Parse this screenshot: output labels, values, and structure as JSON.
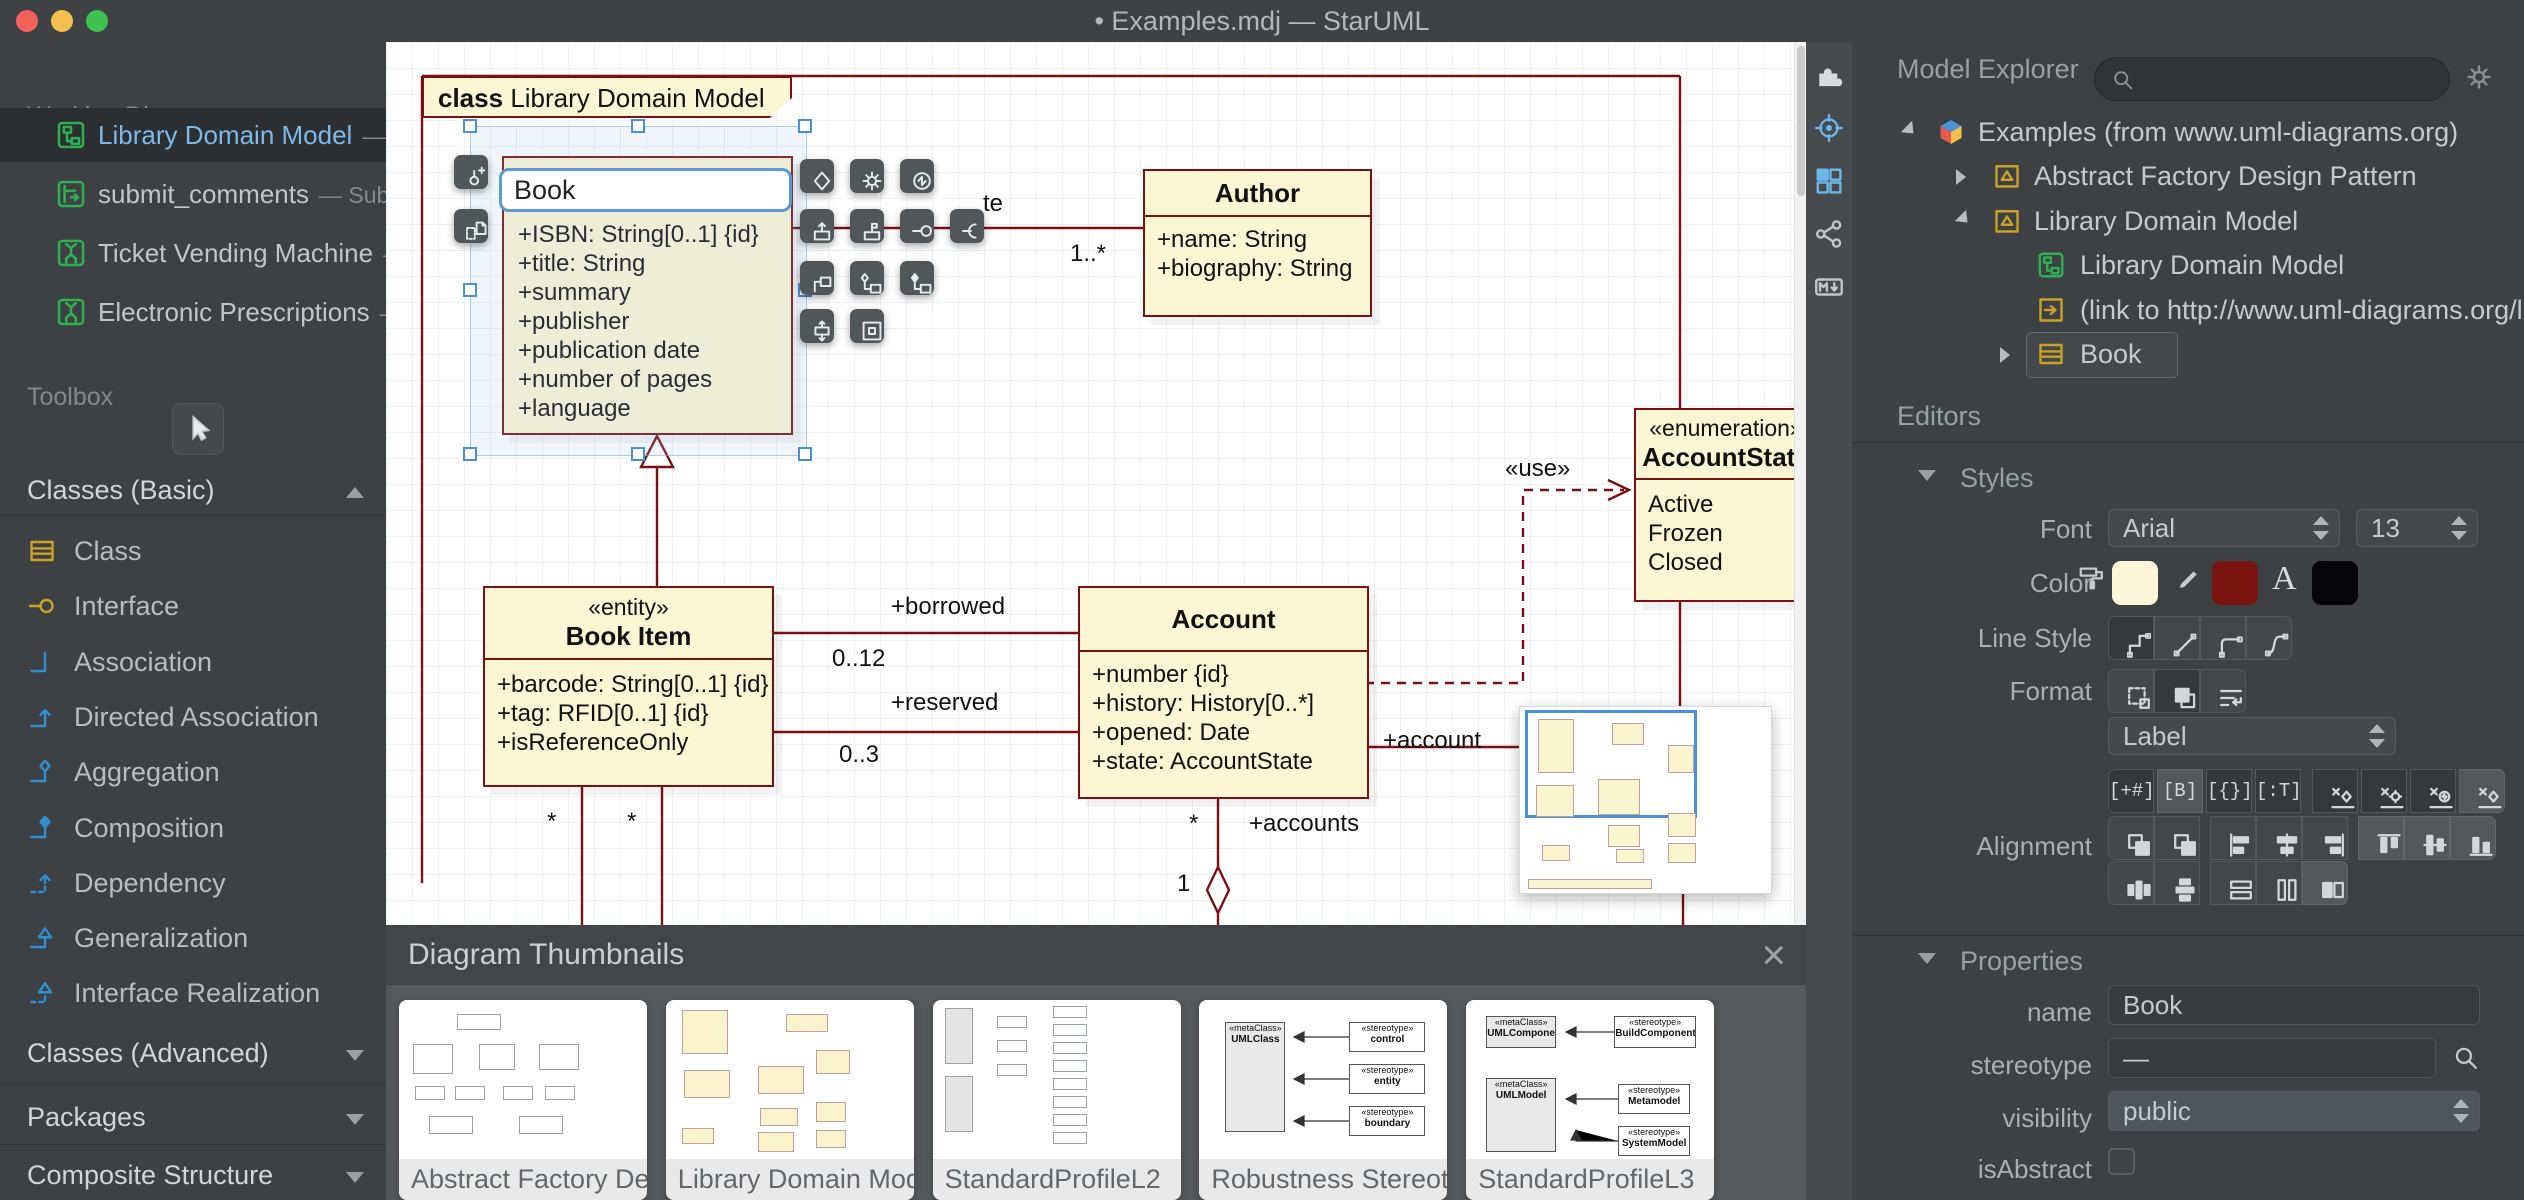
{
  "titlebar": {
    "title": "• Examples.mdj — StarUML"
  },
  "sidebar": {
    "working_diagrams_label": "Working Diagrams",
    "diagrams": [
      {
        "name": "Library Domain Model",
        "suffix": "— Lib",
        "icon": "doc-class",
        "selected": true
      },
      {
        "name": "submit_comments",
        "suffix": "— Submit",
        "icon": "doc-seq",
        "selected": false
      },
      {
        "name": "Ticket Vending Machine",
        "suffix": "— T",
        "icon": "doc-act",
        "selected": false
      },
      {
        "name": "Electronic Prescriptions",
        "suffix": "— E",
        "icon": "doc-act",
        "selected": false
      }
    ],
    "toolbox_label": "Toolbox",
    "sections": [
      {
        "label": "Classes (Basic)",
        "expanded": true,
        "items": [
          {
            "label": "Class",
            "icon": "tb-class",
            "color": "#c9a227"
          },
          {
            "label": "Interface",
            "icon": "tb-interface",
            "color": "#c9a227"
          },
          {
            "label": "Association",
            "icon": "tb-assoc",
            "color": "#2f8fd0"
          },
          {
            "label": "Directed Association",
            "icon": "tb-dassoc",
            "color": "#2f8fd0"
          },
          {
            "label": "Aggregation",
            "icon": "tb-aggr",
            "color": "#2f8fd0"
          },
          {
            "label": "Composition",
            "icon": "tb-comp",
            "color": "#2f8fd0"
          },
          {
            "label": "Dependency",
            "icon": "tb-dep",
            "color": "#2f8fd0"
          },
          {
            "label": "Generalization",
            "icon": "tb-gen",
            "color": "#2f8fd0"
          },
          {
            "label": "Interface Realization",
            "icon": "tb-ireal",
            "color": "#2f8fd0"
          }
        ]
      },
      {
        "label": "Classes (Advanced)",
        "expanded": false,
        "items": []
      },
      {
        "label": "Packages",
        "expanded": false,
        "items": []
      },
      {
        "label": "Composite Structure",
        "expanded": false,
        "items": []
      }
    ]
  },
  "canvas": {
    "frame": {
      "keyword": "class",
      "name": "Library Domain Model"
    },
    "book": {
      "name_value": "Book",
      "attributes": [
        "+ISBN: String[0..1] {id}",
        "+title: String",
        "+summary",
        "+publisher",
        "+publication date",
        "+number of pages",
        "+language"
      ]
    },
    "author": {
      "title": "Author",
      "attributes": [
        "+name: String",
        "+biography: String"
      ]
    },
    "book_item": {
      "stereotype": "«entity»",
      "title": "Book Item",
      "attributes": [
        "+barcode: String[0..1] {id}",
        "+tag: RFID[0..1] {id}",
        "+isReferenceOnly"
      ]
    },
    "account": {
      "title": "Account",
      "attributes": [
        "+number {id}",
        "+history: History[0..*]",
        "+opened: Date",
        "+state: AccountState"
      ]
    },
    "account_state": {
      "stereotype": "«enumeration»",
      "title": "AccountState",
      "literals": [
        "Active",
        "Frozen",
        "Closed"
      ]
    },
    "edge_labels": {
      "use": "«use»",
      "wrote_partial": "te",
      "author_mult": "1..*",
      "borrowed": "+borrowed",
      "borrowed_mult": "0..12",
      "reserved": "+reserved",
      "reserved_mult": "0..3",
      "account_role": "+account",
      "account_mult": "*",
      "accounts_role": "+accounts",
      "accounts_mult": "1",
      "item_mult_a": "*",
      "item_mult_b": "*"
    }
  },
  "floating_toolbar": {
    "left": [
      "add-port-icon",
      "note-link-icon"
    ],
    "rows": [
      [
        "diamond-icon",
        "gear-icon",
        "cycle-icon"
      ],
      [
        "box-up-icon",
        "pin-icon",
        "provided-interface-icon",
        "required-interface-icon"
      ],
      [
        "connect-class-icon",
        "connect-aggregation-icon",
        "connect-composition-icon"
      ],
      [
        "resize-icon",
        "frame-icon"
      ]
    ]
  },
  "thumbnails_panel": {
    "title": "Diagram Thumbnails",
    "close_glyph": "×",
    "cards": [
      {
        "caption": "Abstract Factory Design Pattern",
        "sketch": "gray"
      },
      {
        "caption": "Library Domain Model",
        "sketch": "yellow"
      },
      {
        "caption": "StandardProfileL2",
        "sketch": "profile"
      },
      {
        "caption": "Robustness Stereotypes",
        "sketch": "robustness"
      },
      {
        "caption": "StandardProfileL3",
        "sketch": "profile3"
      }
    ],
    "robustness": {
      "meta": {
        "stereotype": "«metaClass»",
        "name": "UMLClass"
      },
      "stereos": [
        {
          "stereotype": "«stereotype»",
          "name": "control"
        },
        {
          "stereotype": "«stereotype»",
          "name": "entity"
        },
        {
          "stereotype": "«stereotype»",
          "name": "boundary"
        }
      ]
    },
    "profile3": {
      "metas": [
        {
          "stereotype": "«metaClass»",
          "name": "UMLComponent"
        },
        {
          "stereotype": "«metaClass»",
          "name": "UMLModel"
        }
      ],
      "stereos": [
        {
          "stereotype": "«stereotype»",
          "name": "BuildComponent"
        },
        {
          "stereotype": "«stereotype»",
          "name": "Metamodel"
        },
        {
          "stereotype": "«stereotype»",
          "name": "SystemModel"
        }
      ]
    }
  },
  "icon_strip": [
    {
      "name": "extensions-icon",
      "icon": "puzzle",
      "color": "#d9dbdc"
    },
    {
      "name": "crosshair-icon",
      "icon": "crosshair",
      "color": "#6db6e8"
    },
    {
      "name": "thumbnails-icon",
      "icon": "grid4",
      "color": "#6db6e8"
    },
    {
      "name": "share-icon",
      "icon": "share",
      "color": "#c3c6c7"
    },
    {
      "name": "markdown-icon",
      "icon": "markdown",
      "color": "#c3c6c7"
    }
  ],
  "model_explorer": {
    "title": "Model Explorer",
    "search_value": "",
    "tree": [
      {
        "label": "Examples (from www.uml-diagrams.org)",
        "icon": "cube",
        "arrow": "expanded",
        "indent": 0,
        "selected": false
      },
      {
        "label": "Abstract Factory Design Pattern",
        "icon": "pkg",
        "arrow": "collapsed",
        "indent": 1,
        "selected": false
      },
      {
        "label": "Library Domain Model",
        "icon": "pkg",
        "arrow": "expanded",
        "indent": 1,
        "selected": false
      },
      {
        "label": "Library Domain Model",
        "icon": "diag",
        "arrow": "none",
        "indent": 2,
        "selected": false
      },
      {
        "label": "(link to http://www.uml-diagrams.org/library-",
        "icon": "linkicon",
        "arrow": "none",
        "indent": 2,
        "selected": false
      },
      {
        "label": "Book",
        "icon": "clsicon",
        "arrow": "collapsed",
        "indent": 2,
        "selected": true
      }
    ]
  },
  "editors": {
    "title": "Editors",
    "styles_label": "Styles",
    "font_label": "Font",
    "font_family": "Arial",
    "font_size": "13",
    "color_label": "Color",
    "colors": {
      "fill": "#fdf6d8",
      "line": "#7a1410",
      "font": "#060608"
    },
    "line_style_label": "Line Style",
    "line_style_options": [
      {
        "icon": "ls-rect",
        "state": "pressed"
      },
      {
        "icon": "ls-obl",
        "state": ""
      },
      {
        "icon": "ls-round",
        "state": ""
      },
      {
        "icon": "ls-curve",
        "state": ""
      }
    ],
    "format_label": "Format",
    "format_options": [
      {
        "icon": "fmt-rect",
        "state": ""
      },
      {
        "icon": "fmt-fill",
        "state": "pressed"
      },
      {
        "icon": "fmt-wrap",
        "state": ""
      }
    ],
    "label_dropdown_value": "Label",
    "toggle_row": [
      {
        "glyph": "[+#]",
        "state": "pressed"
      },
      {
        "glyph": "[B]",
        "state": "raised"
      },
      {
        "glyph": "[{}]",
        "state": "pressed"
      },
      {
        "glyph": "[:T]",
        "state": "pressed"
      },
      {
        "icon": "hide-di",
        "state": "pressed"
      },
      {
        "icon": "hide-gear",
        "state": "pressed"
      },
      {
        "icon": "hide-circ",
        "state": "pressed"
      },
      {
        "icon": "hide-di",
        "state": "raised"
      }
    ],
    "alignment_label": "Alignment",
    "alignment_row1": [
      {
        "icon": "z-back",
        "state": ""
      },
      {
        "icon": "z-front",
        "state": ""
      },
      {
        "icon": "al-l",
        "state": ""
      },
      {
        "icon": "al-c",
        "state": ""
      },
      {
        "icon": "al-r",
        "state": ""
      },
      {
        "icon": "al-t",
        "state": "raised"
      },
      {
        "icon": "al-m",
        "state": "raised"
      },
      {
        "icon": "al-b",
        "state": "raised"
      }
    ],
    "alignment_row2": [
      {
        "icon": "di-h",
        "state": ""
      },
      {
        "icon": "di-v",
        "state": ""
      },
      {
        "icon": "sm-h",
        "state": ""
      },
      {
        "icon": "sm-w",
        "state": ""
      },
      {
        "icon": "sm-s",
        "state": "raised"
      }
    ],
    "properties": {
      "label": "Properties",
      "name_label": "name",
      "name_value": "Book",
      "stereotype_label": "stereotype",
      "stereotype_value": "—",
      "visibility_label": "visibility",
      "visibility_value": "public",
      "isabstract_label": "isAbstract",
      "isabstract_checked": false
    }
  }
}
